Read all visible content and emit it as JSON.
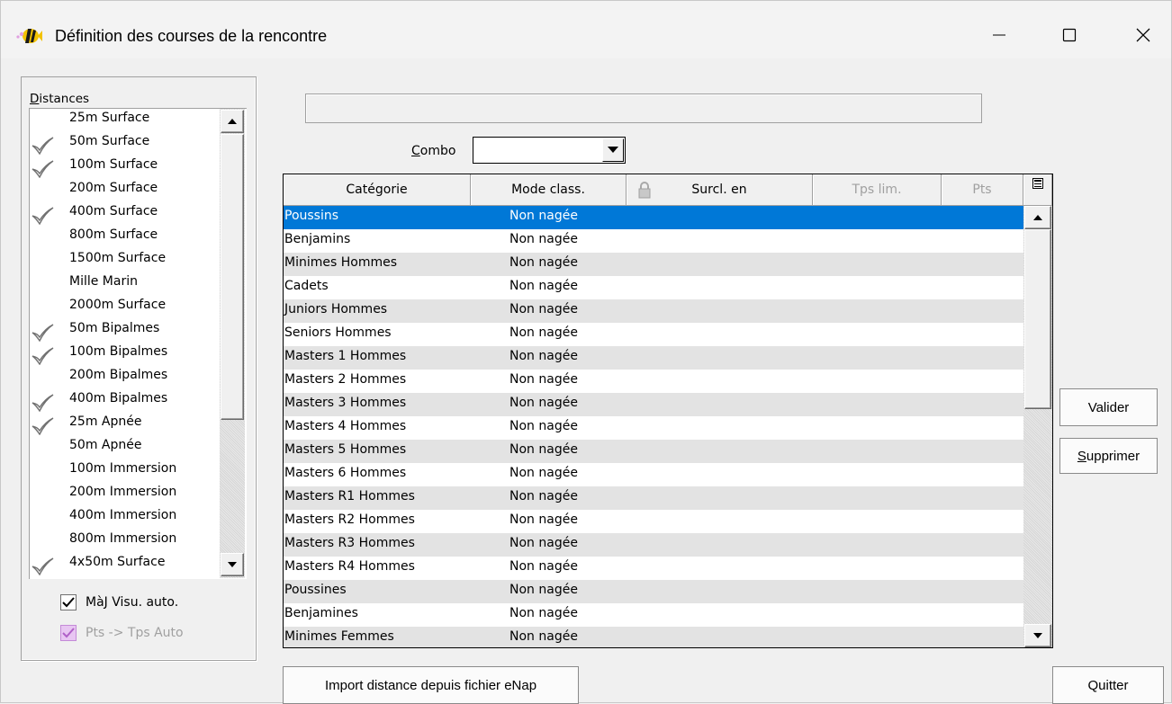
{
  "window": {
    "title": "Définition des courses de la rencontre",
    "app_icon": "fish-icon",
    "controls": [
      "minimize-icon",
      "maximize-icon",
      "close-icon"
    ]
  },
  "distances": {
    "label_underlined": "D",
    "label_rest": "istances",
    "items": [
      {
        "label": "25m Surface",
        "checked": false
      },
      {
        "label": "50m Surface",
        "checked": true
      },
      {
        "label": "100m Surface",
        "checked": true
      },
      {
        "label": "200m Surface",
        "checked": false
      },
      {
        "label": "400m Surface",
        "checked": true
      },
      {
        "label": "800m Surface",
        "checked": false
      },
      {
        "label": "1500m Surface",
        "checked": false
      },
      {
        "label": "Mille Marin",
        "checked": false
      },
      {
        "label": "2000m Surface",
        "checked": false
      },
      {
        "label": "50m Bipalmes",
        "checked": true
      },
      {
        "label": "100m Bipalmes",
        "checked": true
      },
      {
        "label": "200m Bipalmes",
        "checked": false
      },
      {
        "label": "400m Bipalmes",
        "checked": true
      },
      {
        "label": "25m Apnée",
        "checked": true
      },
      {
        "label": "50m Apnée",
        "checked": false
      },
      {
        "label": "100m Immersion",
        "checked": false
      },
      {
        "label": "200m Immersion",
        "checked": false
      },
      {
        "label": "400m Immersion",
        "checked": false
      },
      {
        "label": "800m Immersion",
        "checked": false
      },
      {
        "label": "4x50m Surface",
        "checked": true
      }
    ]
  },
  "options": {
    "maj_visu_auto": {
      "label": "MàJ Visu. auto.",
      "checked": true
    },
    "pts_tps_auto": {
      "label": "Pts -> Tps Auto",
      "checked": true,
      "disabled": true
    }
  },
  "top_field": {
    "value": ""
  },
  "combo": {
    "label_underlined": "C",
    "label_rest": "ombo",
    "value": ""
  },
  "grid": {
    "columns": [
      {
        "label": "Catégorie",
        "dim": false
      },
      {
        "label": "Mode class.",
        "dim": false
      },
      {
        "label": "Surcl. en",
        "dim": false,
        "icon": "lock-icon"
      },
      {
        "label": "Tps lim.",
        "dim": true
      },
      {
        "label": "Pts",
        "dim": true
      }
    ],
    "rows": [
      {
        "categorie": "Poussins",
        "mode": "Non nagée",
        "selected": true
      },
      {
        "categorie": "Benjamins",
        "mode": "Non nagée"
      },
      {
        "categorie": "Minimes Hommes",
        "mode": "Non nagée"
      },
      {
        "categorie": "Cadets",
        "mode": "Non nagée"
      },
      {
        "categorie": "Juniors Hommes",
        "mode": "Non nagée"
      },
      {
        "categorie": "Seniors Hommes",
        "mode": "Non nagée"
      },
      {
        "categorie": "Masters 1 Hommes",
        "mode": "Non nagée"
      },
      {
        "categorie": "Masters 2 Hommes",
        "mode": "Non nagée"
      },
      {
        "categorie": "Masters 3 Hommes",
        "mode": "Non nagée"
      },
      {
        "categorie": "Masters 4 Hommes",
        "mode": "Non nagée"
      },
      {
        "categorie": "Masters 5 Hommes",
        "mode": "Non nagée"
      },
      {
        "categorie": "Masters 6 Hommes",
        "mode": "Non nagée"
      },
      {
        "categorie": "Masters R1 Hommes",
        "mode": "Non nagée"
      },
      {
        "categorie": "Masters R2 Hommes",
        "mode": "Non nagée"
      },
      {
        "categorie": "Masters R3 Hommes",
        "mode": "Non nagée"
      },
      {
        "categorie": "Masters R4 Hommes",
        "mode": "Non nagée"
      },
      {
        "categorie": "Poussines",
        "mode": "Non nagée"
      },
      {
        "categorie": "Benjamines",
        "mode": "Non nagée"
      },
      {
        "categorie": "Minimes Femmes",
        "mode": "Non nagée"
      }
    ]
  },
  "buttons": {
    "valider": "Valider",
    "supprimer_underlined": "S",
    "supprimer_rest": "upprimer",
    "import": "Import distance depuis fichier eNap",
    "quitter": "Quitter"
  }
}
